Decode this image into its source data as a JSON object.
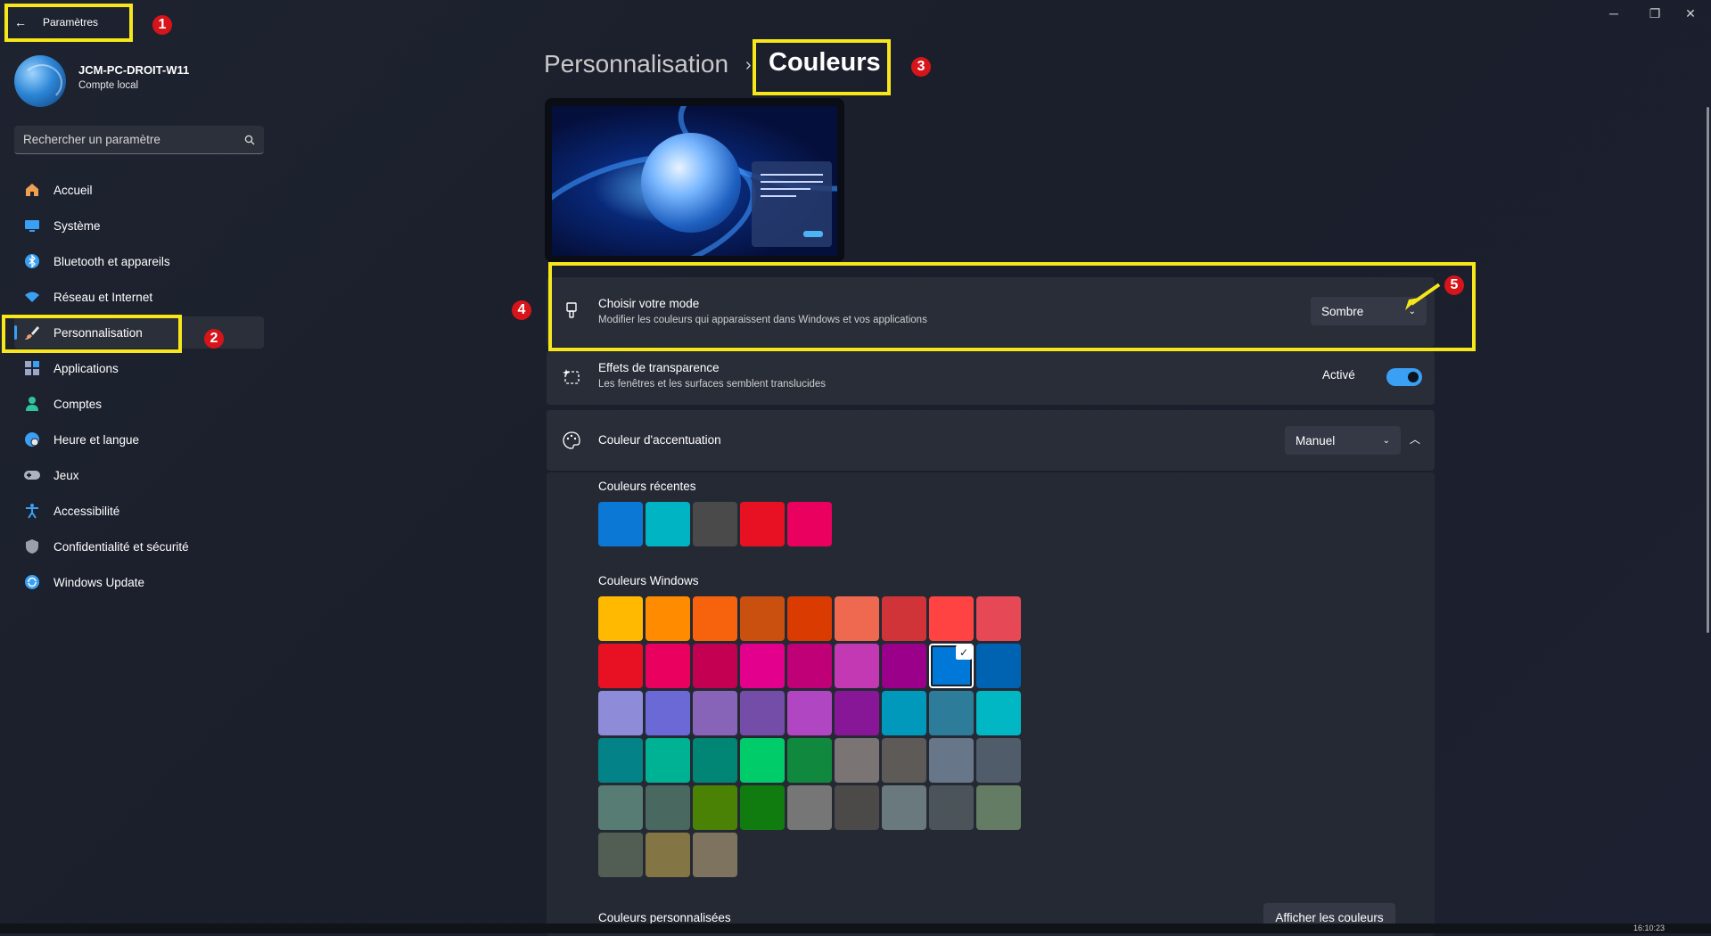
{
  "window": {
    "title": "Paramètres",
    "caption": {
      "minimize": "─",
      "restore": "❐",
      "close": "✕"
    }
  },
  "user": {
    "name": "JCM-PC-DROIT-W11",
    "account": "Compte local"
  },
  "search": {
    "placeholder": "Rechercher un paramètre"
  },
  "sidebar": {
    "items": [
      {
        "label": "Accueil",
        "icon": "home-icon",
        "color": "#f0a050"
      },
      {
        "label": "Système",
        "icon": "system-icon",
        "color": "#3aa0f3"
      },
      {
        "label": "Bluetooth et appareils",
        "icon": "bluetooth-icon",
        "color": "#3aa0f3"
      },
      {
        "label": "Réseau et Internet",
        "icon": "wifi-icon",
        "color": "#3aa0f3"
      },
      {
        "label": "Personnalisation",
        "icon": "brush-icon",
        "color": "#e8a070"
      },
      {
        "label": "Applications",
        "icon": "apps-icon",
        "color": "#9aa6c8"
      },
      {
        "label": "Comptes",
        "icon": "person-icon",
        "color": "#2ec4a0"
      },
      {
        "label": "Heure et langue",
        "icon": "globe-clock-icon",
        "color": "#3aa0f3"
      },
      {
        "label": "Jeux",
        "icon": "gamepad-icon",
        "color": "#aeb4c0"
      },
      {
        "label": "Accessibilité",
        "icon": "accessibility-icon",
        "color": "#3aa0f3"
      },
      {
        "label": "Confidentialité et sécurité",
        "icon": "shield-icon",
        "color": "#9aa0aa"
      },
      {
        "label": "Windows Update",
        "icon": "update-icon",
        "color": "#3aa0f3"
      }
    ],
    "active": "Personnalisation"
  },
  "breadcrumb": {
    "parent": "Personnalisation",
    "separator": "›",
    "current": "Couleurs"
  },
  "mode": {
    "title": "Choisir votre mode",
    "description": "Modifier les couleurs qui apparaissent dans Windows et vos applications",
    "value": "Sombre"
  },
  "transparency": {
    "title": "Effets de transparence",
    "description": "Les fenêtres et les surfaces semblent translucides",
    "state_label": "Activé",
    "on": true
  },
  "accent": {
    "title": "Couleur d'accentuation",
    "value": "Manuel"
  },
  "recent_colors": {
    "label": "Couleurs récentes",
    "colors": [
      "#0a78d4",
      "#00b4c4",
      "#4a4a4a",
      "#e81123",
      "#ea005e"
    ]
  },
  "windows_colors": {
    "label": "Couleurs Windows",
    "selected": "#0078d7",
    "rows": [
      [
        "#ffb900",
        "#ff8c00",
        "#f7630c",
        "#ca5010",
        "#da3b01",
        "#ef6950",
        "#d13438",
        "#ff4343",
        "#e74856"
      ],
      [
        "#e81123",
        "#ea005e",
        "#c30052",
        "#e3008c",
        "#bf0077",
        "#c239b3",
        "#9a0089",
        "#0078d7",
        "#0063b1"
      ],
      [
        "#8e8cd8",
        "#6b69d6",
        "#8764b8",
        "#744da9",
        "#b146c2",
        "#881798",
        "#0099bc",
        "#2d7d9a",
        "#00b7c3"
      ],
      [
        "#038387",
        "#00b294",
        "#018574",
        "#00cc6a",
        "#10893e",
        "#7a7574",
        "#5d5a58",
        "#68768a",
        "#515c6b"
      ],
      [
        "#567c73",
        "#486860",
        "#498205",
        "#107c10",
        "#767676",
        "#4c4a48",
        "#69797e",
        "#4a5459",
        "#647c64"
      ],
      [
        "#525e54",
        "#847545",
        "#7e735f"
      ]
    ]
  },
  "custom_colors": {
    "label": "Couleurs personnalisées",
    "button": "Afficher les couleurs"
  },
  "annotations": [
    "1",
    "2",
    "3",
    "4",
    "5"
  ],
  "highlight_color": "#f6e61a",
  "badge_color": "#d7141a",
  "taskbar": {
    "clock": "16:10:23"
  }
}
